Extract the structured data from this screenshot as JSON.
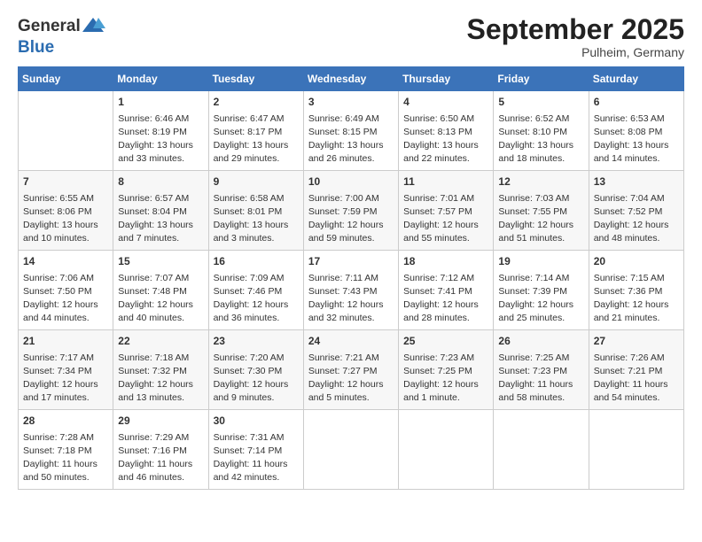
{
  "header": {
    "logo_general": "General",
    "logo_blue": "Blue",
    "month_title": "September 2025",
    "subtitle": "Pulheim, Germany"
  },
  "days_of_week": [
    "Sunday",
    "Monday",
    "Tuesday",
    "Wednesday",
    "Thursday",
    "Friday",
    "Saturday"
  ],
  "weeks": [
    [
      {
        "day": "",
        "info": ""
      },
      {
        "day": "1",
        "info": "Sunrise: 6:46 AM\nSunset: 8:19 PM\nDaylight: 13 hours\nand 33 minutes."
      },
      {
        "day": "2",
        "info": "Sunrise: 6:47 AM\nSunset: 8:17 PM\nDaylight: 13 hours\nand 29 minutes."
      },
      {
        "day": "3",
        "info": "Sunrise: 6:49 AM\nSunset: 8:15 PM\nDaylight: 13 hours\nand 26 minutes."
      },
      {
        "day": "4",
        "info": "Sunrise: 6:50 AM\nSunset: 8:13 PM\nDaylight: 13 hours\nand 22 minutes."
      },
      {
        "day": "5",
        "info": "Sunrise: 6:52 AM\nSunset: 8:10 PM\nDaylight: 13 hours\nand 18 minutes."
      },
      {
        "day": "6",
        "info": "Sunrise: 6:53 AM\nSunset: 8:08 PM\nDaylight: 13 hours\nand 14 minutes."
      }
    ],
    [
      {
        "day": "7",
        "info": "Sunrise: 6:55 AM\nSunset: 8:06 PM\nDaylight: 13 hours\nand 10 minutes."
      },
      {
        "day": "8",
        "info": "Sunrise: 6:57 AM\nSunset: 8:04 PM\nDaylight: 13 hours\nand 7 minutes."
      },
      {
        "day": "9",
        "info": "Sunrise: 6:58 AM\nSunset: 8:01 PM\nDaylight: 13 hours\nand 3 minutes."
      },
      {
        "day": "10",
        "info": "Sunrise: 7:00 AM\nSunset: 7:59 PM\nDaylight: 12 hours\nand 59 minutes."
      },
      {
        "day": "11",
        "info": "Sunrise: 7:01 AM\nSunset: 7:57 PM\nDaylight: 12 hours\nand 55 minutes."
      },
      {
        "day": "12",
        "info": "Sunrise: 7:03 AM\nSunset: 7:55 PM\nDaylight: 12 hours\nand 51 minutes."
      },
      {
        "day": "13",
        "info": "Sunrise: 7:04 AM\nSunset: 7:52 PM\nDaylight: 12 hours\nand 48 minutes."
      }
    ],
    [
      {
        "day": "14",
        "info": "Sunrise: 7:06 AM\nSunset: 7:50 PM\nDaylight: 12 hours\nand 44 minutes."
      },
      {
        "day": "15",
        "info": "Sunrise: 7:07 AM\nSunset: 7:48 PM\nDaylight: 12 hours\nand 40 minutes."
      },
      {
        "day": "16",
        "info": "Sunrise: 7:09 AM\nSunset: 7:46 PM\nDaylight: 12 hours\nand 36 minutes."
      },
      {
        "day": "17",
        "info": "Sunrise: 7:11 AM\nSunset: 7:43 PM\nDaylight: 12 hours\nand 32 minutes."
      },
      {
        "day": "18",
        "info": "Sunrise: 7:12 AM\nSunset: 7:41 PM\nDaylight: 12 hours\nand 28 minutes."
      },
      {
        "day": "19",
        "info": "Sunrise: 7:14 AM\nSunset: 7:39 PM\nDaylight: 12 hours\nand 25 minutes."
      },
      {
        "day": "20",
        "info": "Sunrise: 7:15 AM\nSunset: 7:36 PM\nDaylight: 12 hours\nand 21 minutes."
      }
    ],
    [
      {
        "day": "21",
        "info": "Sunrise: 7:17 AM\nSunset: 7:34 PM\nDaylight: 12 hours\nand 17 minutes."
      },
      {
        "day": "22",
        "info": "Sunrise: 7:18 AM\nSunset: 7:32 PM\nDaylight: 12 hours\nand 13 minutes."
      },
      {
        "day": "23",
        "info": "Sunrise: 7:20 AM\nSunset: 7:30 PM\nDaylight: 12 hours\nand 9 minutes."
      },
      {
        "day": "24",
        "info": "Sunrise: 7:21 AM\nSunset: 7:27 PM\nDaylight: 12 hours\nand 5 minutes."
      },
      {
        "day": "25",
        "info": "Sunrise: 7:23 AM\nSunset: 7:25 PM\nDaylight: 12 hours\nand 1 minute."
      },
      {
        "day": "26",
        "info": "Sunrise: 7:25 AM\nSunset: 7:23 PM\nDaylight: 11 hours\nand 58 minutes."
      },
      {
        "day": "27",
        "info": "Sunrise: 7:26 AM\nSunset: 7:21 PM\nDaylight: 11 hours\nand 54 minutes."
      }
    ],
    [
      {
        "day": "28",
        "info": "Sunrise: 7:28 AM\nSunset: 7:18 PM\nDaylight: 11 hours\nand 50 minutes."
      },
      {
        "day": "29",
        "info": "Sunrise: 7:29 AM\nSunset: 7:16 PM\nDaylight: 11 hours\nand 46 minutes."
      },
      {
        "day": "30",
        "info": "Sunrise: 7:31 AM\nSunset: 7:14 PM\nDaylight: 11 hours\nand 42 minutes."
      },
      {
        "day": "",
        "info": ""
      },
      {
        "day": "",
        "info": ""
      },
      {
        "day": "",
        "info": ""
      },
      {
        "day": "",
        "info": ""
      }
    ]
  ]
}
